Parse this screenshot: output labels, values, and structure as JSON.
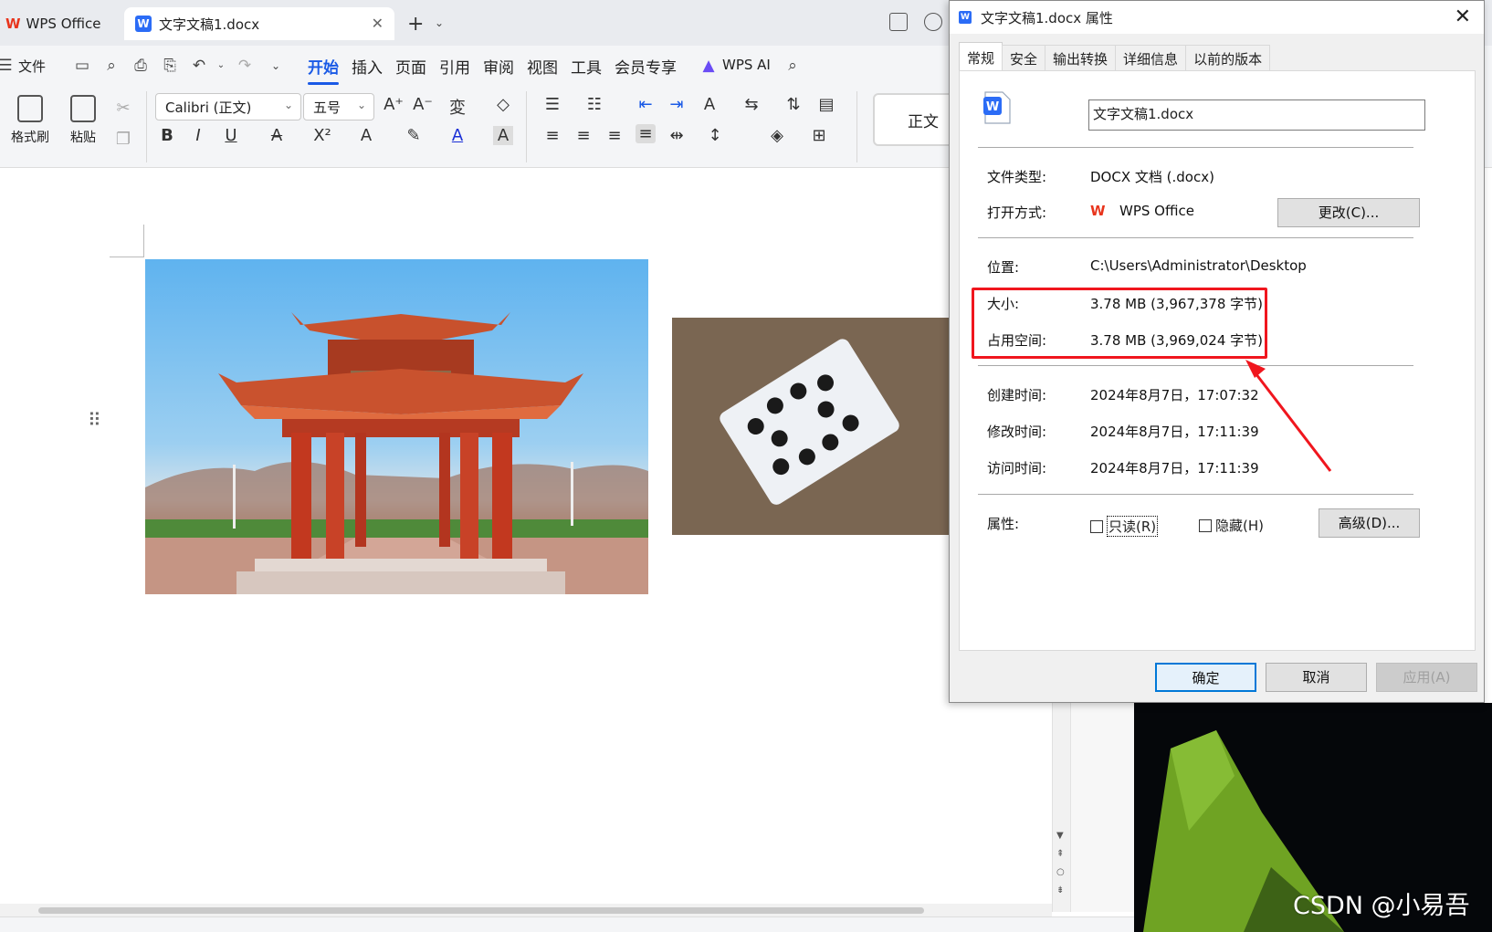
{
  "tabs": {
    "home_label": "WPS Office",
    "doc_label": "文字文稿1.docx"
  },
  "menubar": {
    "file": "文件",
    "items": [
      "开始",
      "插入",
      "页面",
      "引用",
      "审阅",
      "视图",
      "工具",
      "会员专享"
    ],
    "ai": "WPS AI"
  },
  "ribbon": {
    "format_painter": "格式刷",
    "paste": "粘贴",
    "font_name": "Calibri (正文)",
    "font_size": "五号",
    "style_normal": "正文"
  },
  "dialog": {
    "title": "文字文稿1.docx 属性",
    "tabs": [
      "常规",
      "安全",
      "输出转换",
      "详细信息",
      "以前的版本"
    ],
    "file_name": "文字文稿1.docx",
    "rows": {
      "type_label": "文件类型:",
      "type_value": "DOCX 文档 (.docx)",
      "open_label": "打开方式:",
      "open_value": "WPS Office",
      "change_button": "更改(C)...",
      "location_label": "位置:",
      "location_value": "C:\\Users\\Administrator\\Desktop",
      "size_label": "大小:",
      "size_value": "3.78 MB (3,967,378 字节)",
      "disk_label": "占用空间:",
      "disk_value": "3.78 MB (3,969,024 字节)",
      "created_label": "创建时间:",
      "created_value": "2024年8月7日，17:07:32",
      "modified_label": "修改时间:",
      "modified_value": "2024年8月7日，17:11:39",
      "accessed_label": "访问时间:",
      "accessed_value": "2024年8月7日，17:11:39",
      "attr_label": "属性:",
      "readonly": "只读(R)",
      "hidden": "隐藏(H)",
      "advanced_button": "高级(D)..."
    },
    "buttons": {
      "ok": "确定",
      "cancel": "取消",
      "apply": "应用(A)"
    },
    "accent": "#f0161e"
  },
  "watermark": "CSDN @小易吾"
}
